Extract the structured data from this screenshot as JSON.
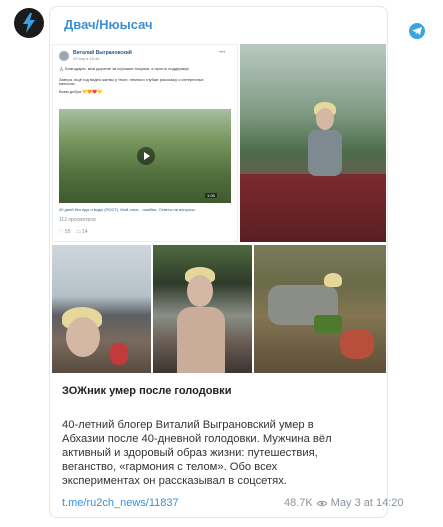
{
  "channel": {
    "name": "Двач/Нюысач"
  },
  "embedded_post": {
    "author": "Виталий Выграновский",
    "date": "25 апр в 18:46",
    "text_line1": "🙏 Благодарю, мои дорогие за хорошие покупки, я просто поддержку!",
    "text_line2": "Завтра, ещё год видео жатвы у текст, немного глубже расскажу о интересных мелочах.",
    "text_line3": "Всем добра 💛🧡❤️💛",
    "video_duration": "1:08",
    "video_caption": "40 дней без еды и воды (ПОСТ). Мой опыт... ошибки. Ответы на вопросы.",
    "video_views": "112 просмотров",
    "likes": "55",
    "comments": "14"
  },
  "post": {
    "title": "ЗОЖник умер после голодовки",
    "body": "40-летний блогер Виталий Выграновский умер в Абхазии после 40-дневной голодовки. Мужчина вёл активный и здоровый образ жизни: путешествия, веганство, «гармония с телом». Обо всех экспериментах он рассказывал в соцсетях.",
    "link": "t.me/ru2ch_news/11837",
    "views": "48.7K",
    "date": "May 3 at 14:20"
  },
  "colors": {
    "accent": "#3a8fd5",
    "telegram": "#37a5e0"
  }
}
